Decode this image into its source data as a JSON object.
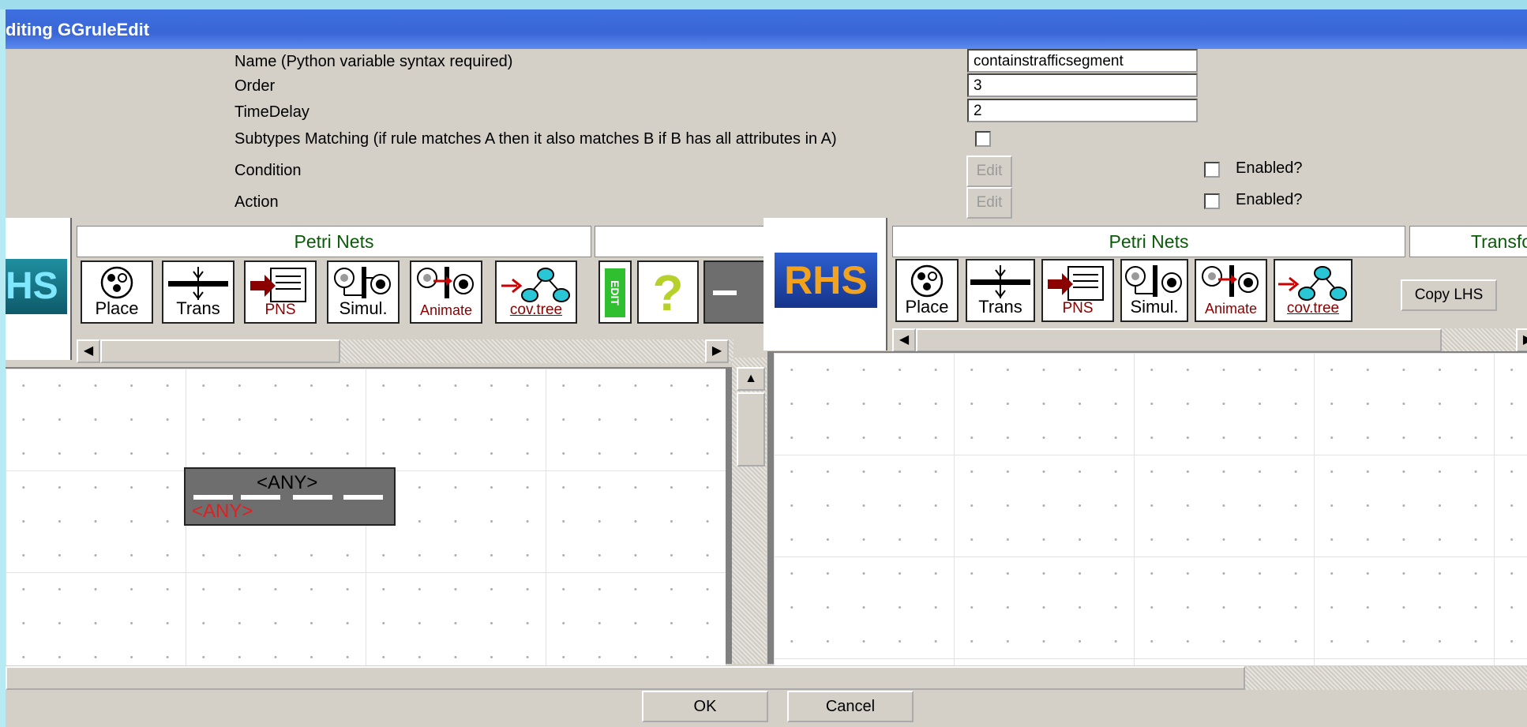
{
  "window": {
    "title": "diting GGruleEdit"
  },
  "form": {
    "name_label": "Name (Python variable syntax required)",
    "name_value": "containstrafficsegment",
    "order_label": "Order",
    "order_value": "3",
    "timedelay_label": "TimeDelay",
    "timedelay_value": "2",
    "subtypes_label": "Subtypes Matching (if rule matches A then it also matches B if B has all attributes in A)",
    "condition_label": "Condition",
    "action_label": "Action",
    "edit_label": "Edit",
    "enabled_label": "Enabled?"
  },
  "lhs": {
    "logo_text": "HS",
    "tab_petri": "Petri Nets",
    "tools": [
      "Place",
      "Trans",
      "PNS",
      "Simul.",
      "Animate",
      "cov.tree"
    ],
    "edit_icon_text": "EDIT",
    "help_icon_text": "?",
    "node_top_label": "<ANY>",
    "node_bottom_label": "<ANY>"
  },
  "rhs": {
    "logo_text": "RHS",
    "tab_petri": "Petri Nets",
    "tab_transform": "Transfo",
    "tools": [
      "Place",
      "Trans",
      "PNS",
      "Simul.",
      "Animate",
      "cov.tree"
    ],
    "copy_lhs": "Copy LHS"
  },
  "footer": {
    "ok": "OK",
    "cancel": "Cancel"
  },
  "colors": {
    "title_blue": "#3a66d6",
    "tab_green": "#0a5a0a",
    "accent_red": "#8b0000",
    "node_fill": "#6e6e6e"
  }
}
